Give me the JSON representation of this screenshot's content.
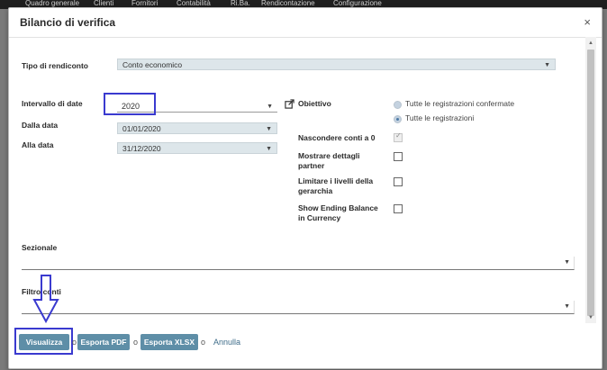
{
  "background": {
    "menu": [
      "Quadro generale",
      "Clienti",
      "Fornitori",
      "Contabilità",
      "Ri.Ba.",
      "Rendicontazione",
      "Configurazione"
    ]
  },
  "modal": {
    "title": "Bilancio di verifica",
    "close_icon": "close-icon",
    "report_type": {
      "label": "Tipo di rendiconto",
      "value": "Conto economico"
    },
    "date_range": {
      "label": "Intervallo di date",
      "value": "2020"
    },
    "date_from": {
      "label": "Dalla data",
      "value": "01/01/2020"
    },
    "date_to": {
      "label": "Alla data",
      "value": "31/12/2020"
    },
    "target": {
      "label": "Obiettivo",
      "options": [
        {
          "label": "Tutte le registrazioni confermate",
          "checked": false
        },
        {
          "label": "Tutte le registrazioni",
          "checked": true
        }
      ]
    },
    "checkboxes": [
      {
        "label": "Nascondere conti a 0",
        "checked": true
      },
      {
        "label": "Mostrare dettagli partner",
        "checked": false
      },
      {
        "label": "Limitare i livelli della gerarchia",
        "checked": false
      },
      {
        "label": "Show Ending Balance in Currency",
        "checked": false
      }
    ],
    "section": {
      "label": "Sezionale"
    },
    "account_filter": {
      "label": "Filtro conti"
    },
    "footer": {
      "view_button": "Visualizza",
      "pdf_button": "Esporta PDF",
      "xlsx_button": "Esporta XLSX",
      "or": "o",
      "cancel_link": "Annulla"
    },
    "colors": {
      "button": "#5e8ea7",
      "highlight": "#3a3acf",
      "select_bg": "#dde6ea"
    }
  }
}
